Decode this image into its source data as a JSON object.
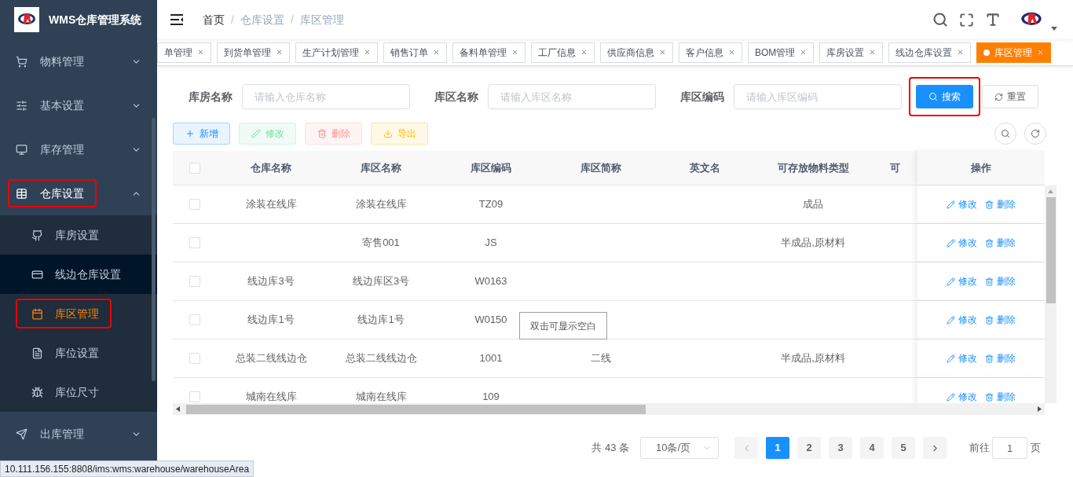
{
  "app": {
    "title": "WMS仓库管理系统"
  },
  "sidebar": {
    "items": [
      {
        "label": "物料管理",
        "expanded": false,
        "highlighted": false
      },
      {
        "label": "基本设置",
        "expanded": false,
        "highlighted": false
      },
      {
        "label": "库存管理",
        "expanded": false,
        "highlighted": false
      },
      {
        "label": "仓库设置",
        "expanded": true,
        "highlighted": true,
        "children": [
          {
            "label": "库房设置",
            "selected": false,
            "hovered": false,
            "highlighted": false
          },
          {
            "label": "线边仓库设置",
            "selected": false,
            "hovered": true,
            "highlighted": false
          },
          {
            "label": "库区管理",
            "selected": true,
            "hovered": false,
            "highlighted": true
          },
          {
            "label": "库位设置",
            "selected": false,
            "hovered": false,
            "highlighted": false
          },
          {
            "label": "库位尺寸",
            "selected": false,
            "hovered": false,
            "highlighted": false
          }
        ]
      },
      {
        "label": "出库管理",
        "expanded": false,
        "highlighted": false
      }
    ]
  },
  "breadcrumb": [
    {
      "kind": "link",
      "text": "首页"
    },
    {
      "kind": "separator",
      "text": "/"
    },
    {
      "kind": "current",
      "text": "仓库设置"
    },
    {
      "kind": "separator",
      "text": "/"
    },
    {
      "kind": "current",
      "text": "库区管理"
    }
  ],
  "tags": [
    {
      "label": "单管理",
      "selected": false
    },
    {
      "label": "到货单管理",
      "selected": false
    },
    {
      "label": "生产计划管理",
      "selected": false
    },
    {
      "label": "销售订单",
      "selected": false
    },
    {
      "label": "备料单管理",
      "selected": false
    },
    {
      "label": "工厂信息",
      "selected": false
    },
    {
      "label": "供应商信息",
      "selected": false
    },
    {
      "label": "客户信息",
      "selected": false
    },
    {
      "label": "BOM管理",
      "selected": false
    },
    {
      "label": "库房设置",
      "selected": false
    },
    {
      "label": "线边仓库设置",
      "selected": false
    },
    {
      "label": "库区管理",
      "selected": true
    }
  ],
  "search_form": {
    "fields": [
      {
        "label": "库房名称",
        "placeholder": "请输入仓库名称"
      },
      {
        "label": "库区名称",
        "placeholder": "请输入库区名称"
      },
      {
        "label": "库区编码",
        "placeholder": "请输入库区编码"
      }
    ],
    "search_button": {
      "label": "搜索",
      "highlighted": true
    },
    "reset_button": {
      "label": "重置"
    }
  },
  "toolbar": [
    {
      "label": "新增",
      "kind": "add",
      "disabled": false
    },
    {
      "label": "修改",
      "kind": "edit",
      "disabled": true
    },
    {
      "label": "删除",
      "kind": "delete",
      "disabled": true
    },
    {
      "label": "导出",
      "kind": "export",
      "disabled": false
    }
  ],
  "table": {
    "all_checked": false,
    "columns": [
      "仓库名称",
      "库区名称",
      "库区编码",
      "库区简称",
      "英文名",
      "可存放物料类型",
      "可"
    ],
    "action_column": "操作",
    "rows": [
      {
        "checked": false,
        "cells": [
          "涂装在线库",
          "涂装在线库",
          "TZ09",
          "",
          "",
          "成品",
          ""
        ],
        "actions": [
          "修改",
          "删除"
        ]
      },
      {
        "checked": false,
        "cells": [
          "",
          "寄售001",
          "JS",
          "",
          "",
          "半成品,原材料",
          ""
        ],
        "actions": [
          "修改",
          "删除"
        ]
      },
      {
        "checked": false,
        "cells": [
          "线边库3号",
          "线边库区3号",
          "W0163",
          "",
          "",
          "",
          ""
        ],
        "actions": [
          "修改",
          "删除"
        ]
      },
      {
        "checked": false,
        "cells": [
          "线边库1号",
          "线边库1号",
          "W0150",
          "",
          "",
          "",
          ""
        ],
        "actions": [
          "修改",
          "删除"
        ]
      },
      {
        "checked": false,
        "cells": [
          "总装二线线边仓",
          "总装二线线边仓",
          "1001",
          "二线",
          "",
          "半成品,原材料",
          ""
        ],
        "actions": [
          "修改",
          "删除"
        ]
      },
      {
        "checked": false,
        "cells": [
          "城南在线库",
          "城南在线库",
          "109",
          "",
          "",
          "",
          ""
        ],
        "actions": [
          "修改",
          "删除"
        ]
      }
    ],
    "tooltip": "双击可显示空白"
  },
  "pagination": {
    "total": "共 43 条",
    "page_size": "10条/页",
    "pages": [
      {
        "label": "1",
        "selected": true
      },
      {
        "label": "2",
        "selected": false
      },
      {
        "label": "3",
        "selected": false
      },
      {
        "label": "4",
        "selected": false
      },
      {
        "label": "5",
        "selected": false
      }
    ],
    "goto_label": "前往",
    "goto_value": "1",
    "goto_suffix": "页"
  },
  "status_bar": "10.111.156.155:8808/ims:wms:warehouse/warehouseArea"
}
